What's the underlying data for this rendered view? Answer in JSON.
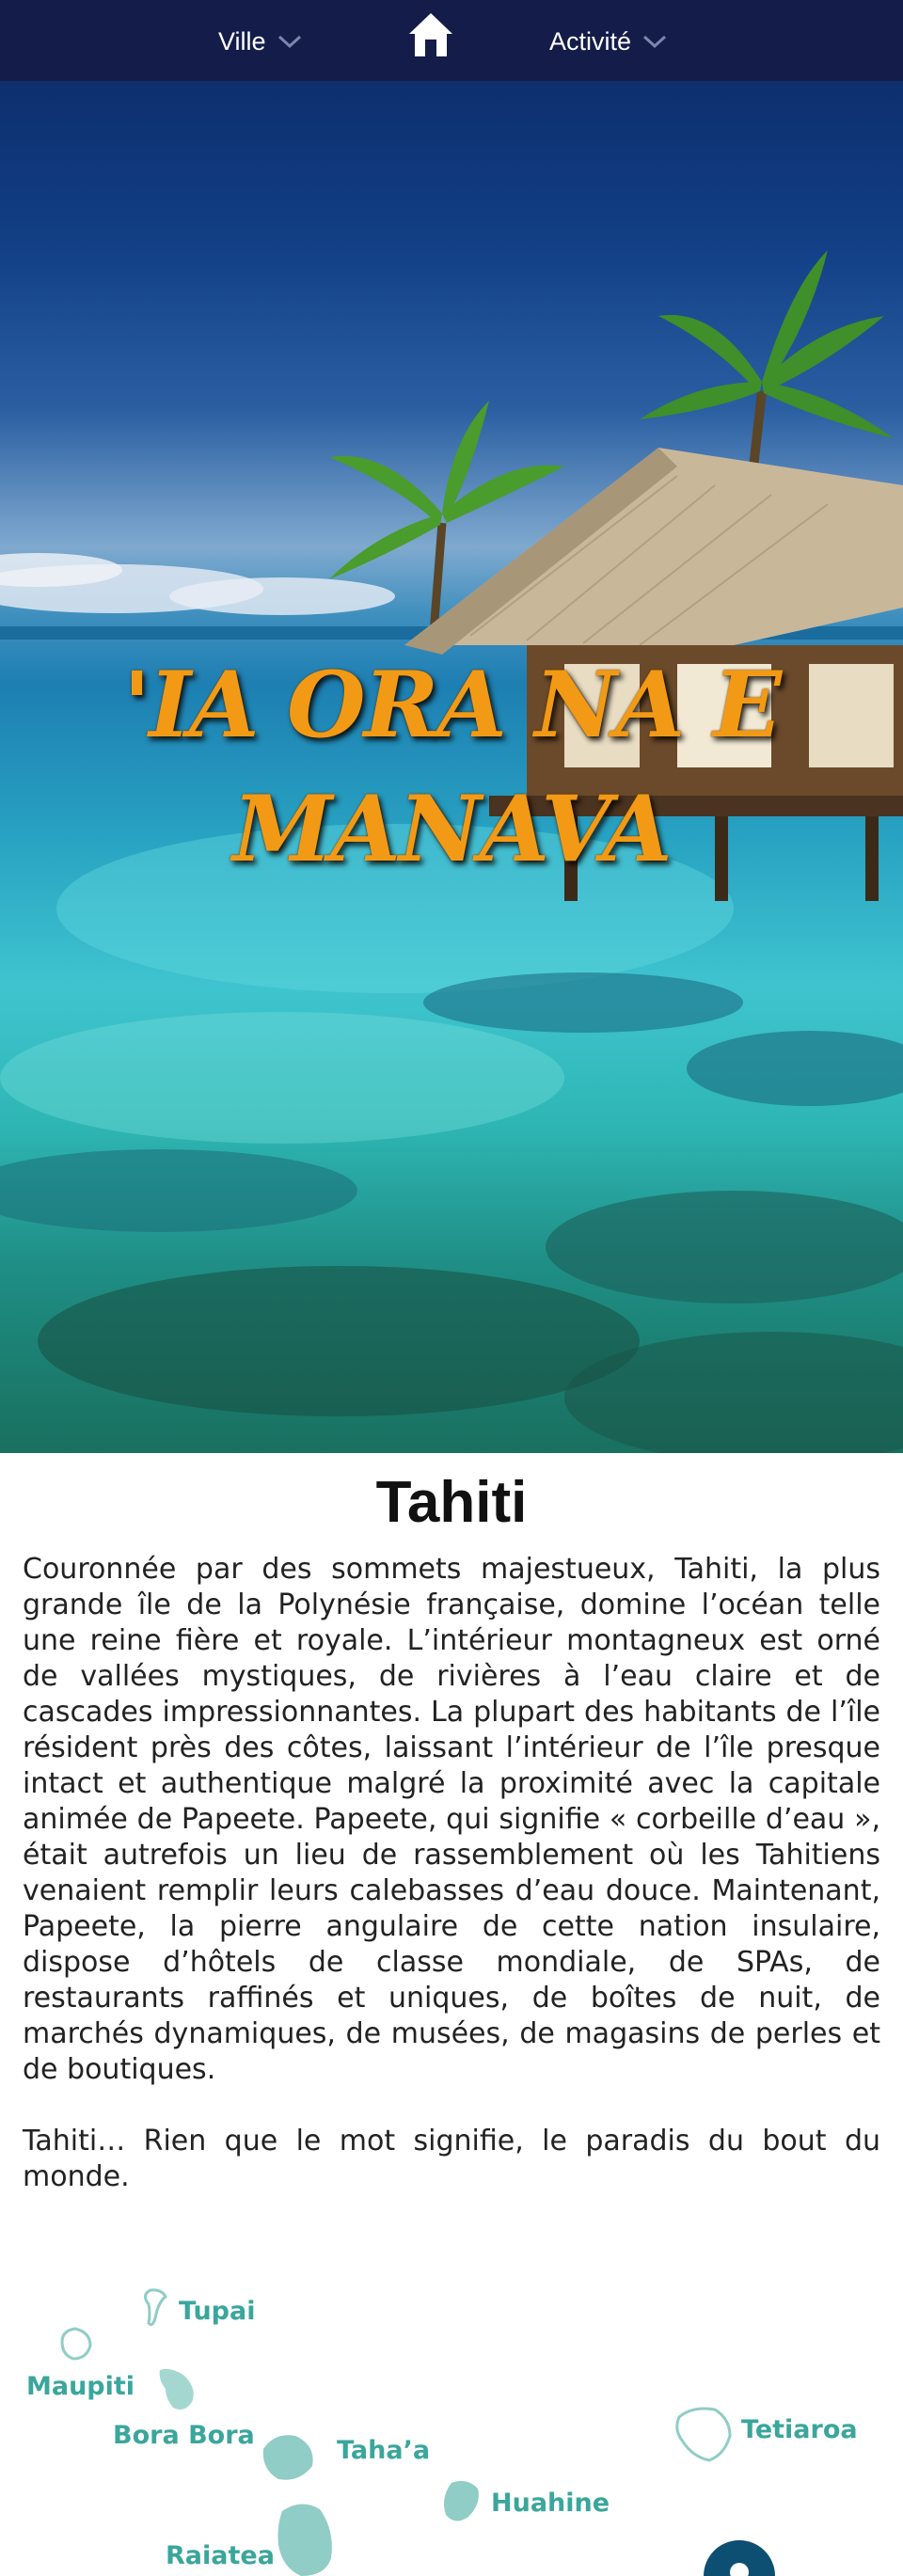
{
  "nav": {
    "ville_label": "Ville",
    "activite_label": "Activité",
    "home_icon": "home-icon",
    "chevron_icon": "chevron-down-icon",
    "bg_color": "#141c4a"
  },
  "hero": {
    "title_line1": "'IA ORA NA E",
    "title_line2": "MANAVA",
    "title_color": "#f29a15"
  },
  "content": {
    "title": "Tahiti",
    "paragraph1": "Couronnée par des sommets majestueux, Tahiti, la plus grande île de la Polynésie française, domine l’océan telle une reine fière et royale. L’intérieur montagneux est orné de vallées mystiques, de rivières à l’eau claire et de cascades impressionnantes. La plupart des habitants de l’île résident près des côtes, laissant l’intérieur de l’île presque intact et authentique malgré la proximité avec la capitale animée de Papeete. Papeete, qui signifie « corbeille d’eau », était autrefois un lieu de rassemblement où les Tahitiens venaient remplir leurs calebasses d’eau douce. Maintenant, Papeete, la pierre angulaire de cette nation insulaire, dispose d’hôtels de classe mondiale, de SPAs, de restaurants raffinés et uniques, de boîtes de nuit, de marchés dynamiques, de musées, de magasins de perles et de boutiques.",
    "paragraph2": "Tahiti… Rien que le mot signifie, le paradis du bout du monde."
  },
  "map": {
    "accent_color": "#3aa69c",
    "islands": [
      {
        "label": "Tupai"
      },
      {
        "label": "Maupiti"
      },
      {
        "label": "Bora Bora"
      },
      {
        "label": "Taha’a"
      },
      {
        "label": "Tetiaroa"
      },
      {
        "label": "Huahine"
      },
      {
        "label": "Raiatea"
      }
    ],
    "marker_icon": "map-pin-icon"
  }
}
